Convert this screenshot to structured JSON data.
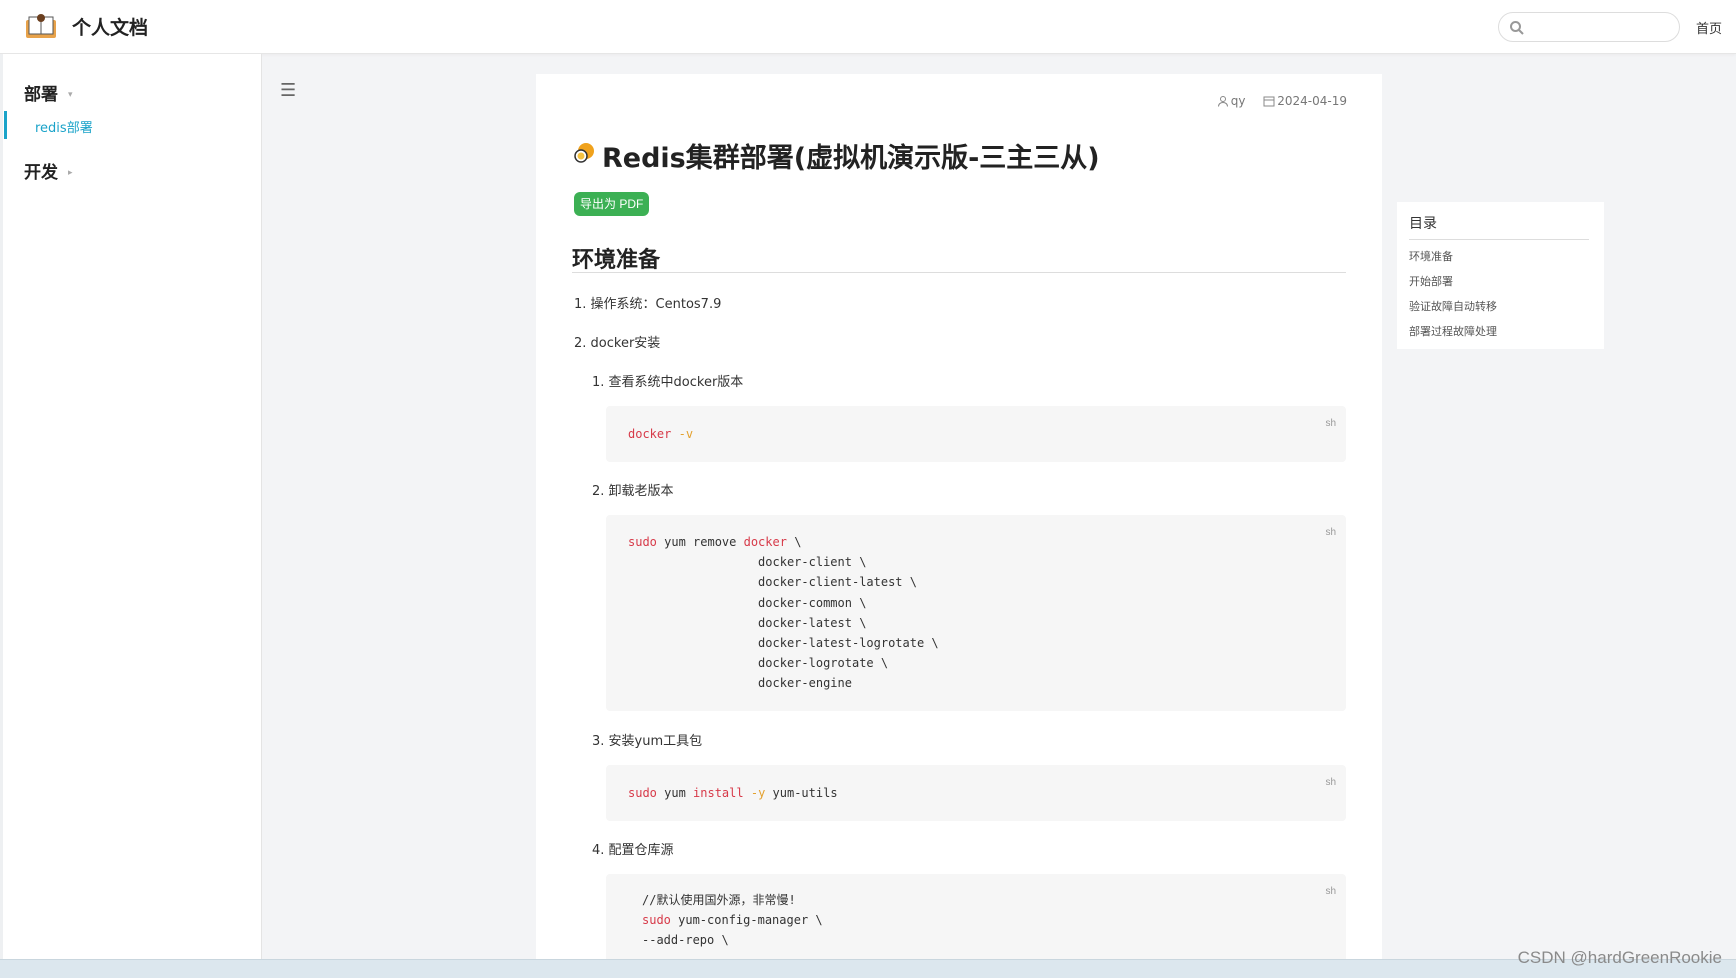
{
  "header": {
    "site_title": "个人文档",
    "search_placeholder": "",
    "home_label": "首页"
  },
  "sidebar": {
    "groups": [
      {
        "label": "部署",
        "expanded": true
      },
      {
        "label": "开发",
        "expanded": false
      }
    ],
    "active_item": "redis部署",
    "caret_open": "▾",
    "caret_closed": "▸"
  },
  "menu_toggle": "☰",
  "article": {
    "author": "qy",
    "date": "2024-04-19",
    "title": "Redis集群部署(虚拟机演示版-三主三从)",
    "export_pdf_label": "导出为 PDF",
    "section_heading": "环境准备",
    "items": {
      "step1": "1. 操作系统：Centos7.9",
      "step2": "2. docker安装",
      "sub1": "1. 查看系统中docker版本",
      "sub2": "2. 卸载老版本",
      "sub3": "3. 安装yum工具包",
      "sub4": "4. 配置仓库源"
    },
    "code_lang": "sh"
  },
  "toc": {
    "title": "目录",
    "items": [
      "环境准备",
      "开始部署",
      "验证故障自动转移",
      "部署过程故障处理"
    ]
  },
  "watermark": "CSDN @hardGreenRookie",
  "colors": {
    "accent": "#1aa3c9",
    "pdf_button": "#3cb054",
    "keyword": "#d73a49",
    "flag": "#e3a12f"
  }
}
